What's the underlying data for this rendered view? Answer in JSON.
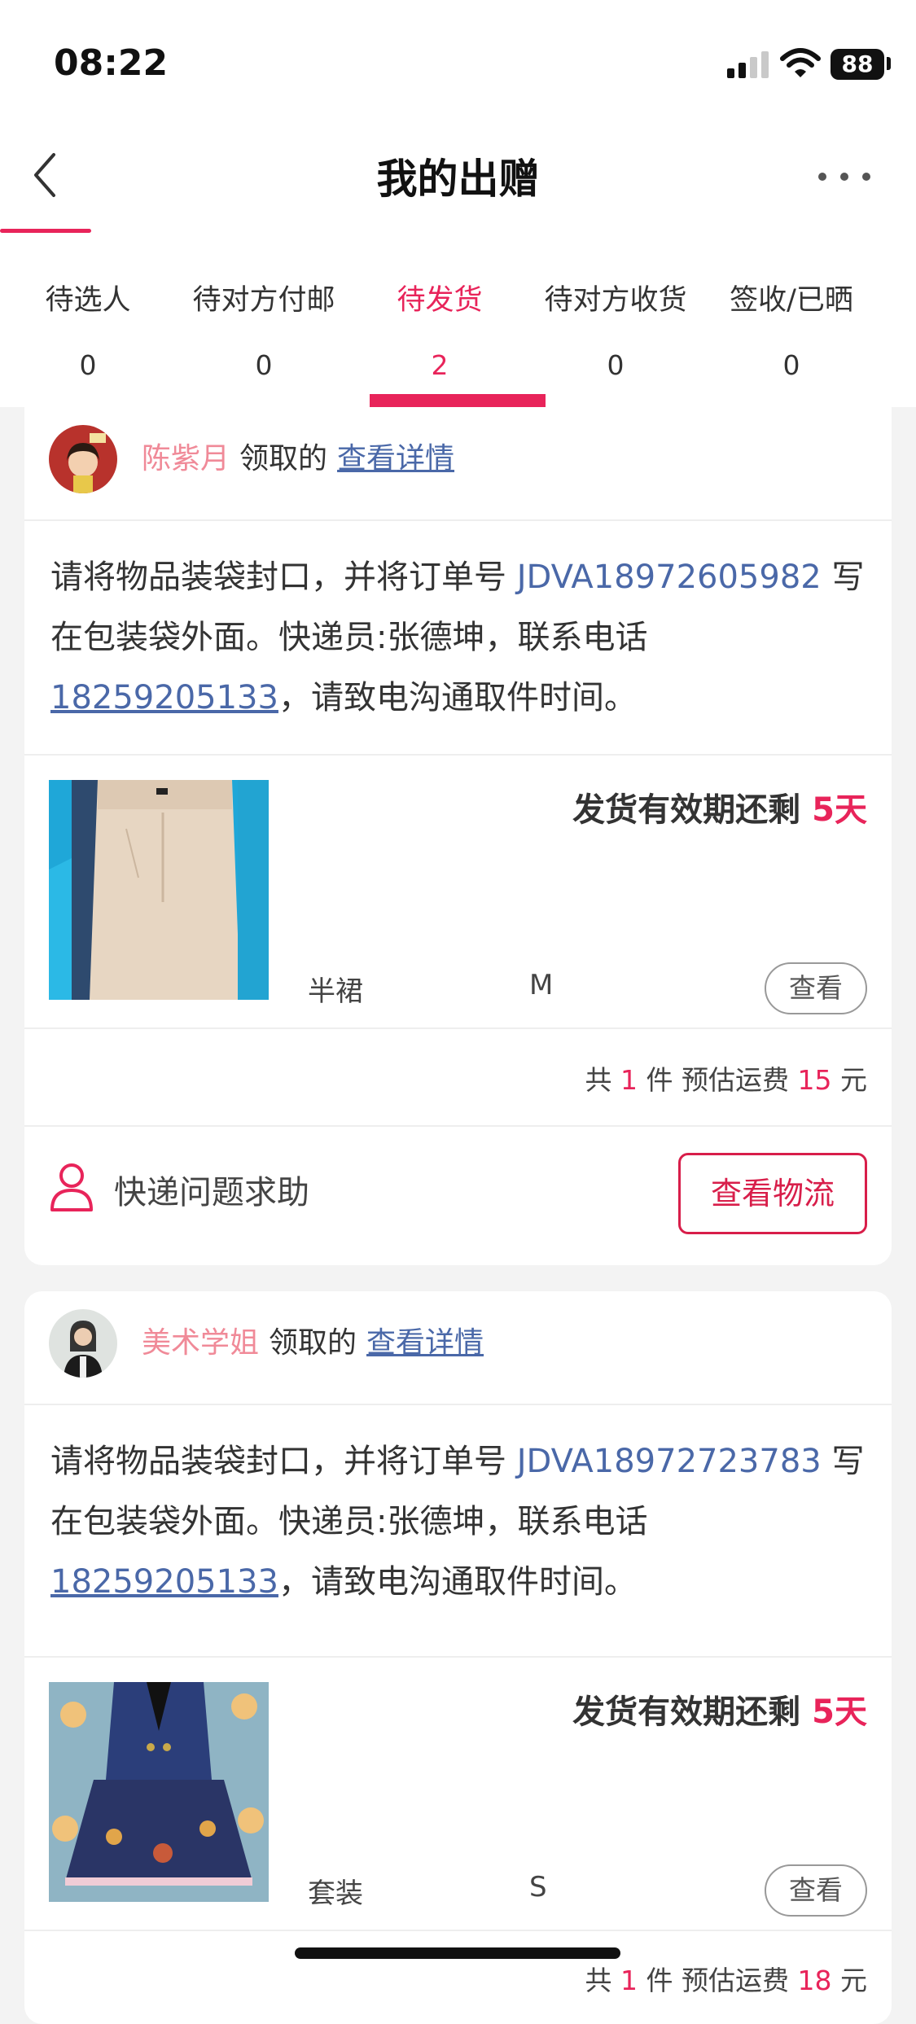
{
  "status_bar": {
    "time": "08:22",
    "battery": "88"
  },
  "header": {
    "title": "我的出赠"
  },
  "tabs": [
    {
      "label": "待选人",
      "count": "0"
    },
    {
      "label": "待对方付邮",
      "count": "0"
    },
    {
      "label": "待发货",
      "count": "2"
    },
    {
      "label": "待对方收货",
      "count": "0"
    },
    {
      "label": "签收/已晒",
      "count": "0"
    }
  ],
  "orders": [
    {
      "user": "陈紫月",
      "claim_text": "领取的",
      "detail_link": "查看详情",
      "instruction_prefix": "请将物品装袋封口，并将订单号 ",
      "order_no": "JDVA18972605982",
      "instruction_mid": " 写在包装袋外面。快递员:张德坤，联系电话",
      "phone": "18259205133",
      "instruction_suffix": "，请致电沟通取件时间。",
      "deadline_label": "发货有效期还剩",
      "deadline_days": "5天",
      "item_name": "半裙",
      "item_size": "M",
      "view_label": "查看",
      "summary_prefix": "共",
      "summary_count": "1",
      "summary_mid": "件 预估运费",
      "summary_fee": "15",
      "summary_unit": "元",
      "help_label": "快递问题求助",
      "logistics_label": "查看物流"
    },
    {
      "user": "美术学姐",
      "claim_text": "领取的",
      "detail_link": "查看详情",
      "instruction_prefix": "请将物品装袋封口，并将订单号 ",
      "order_no": "JDVA18972723783",
      "instruction_mid": " 写在包装袋外面。快递员:张德坤，联系电话",
      "phone": "18259205133",
      "instruction_suffix": "，请致电沟通取件时间。",
      "deadline_label": "发货有效期还剩",
      "deadline_days": "5天",
      "item_name": "套装",
      "item_size": "S",
      "view_label": "查看",
      "summary_prefix": "共",
      "summary_count": "1",
      "summary_mid": "件 预估运费",
      "summary_fee": "18",
      "summary_unit": "元"
    }
  ],
  "colors": {
    "accent": "#e8245a",
    "link": "#4a68a8",
    "username": "#f08a98"
  }
}
